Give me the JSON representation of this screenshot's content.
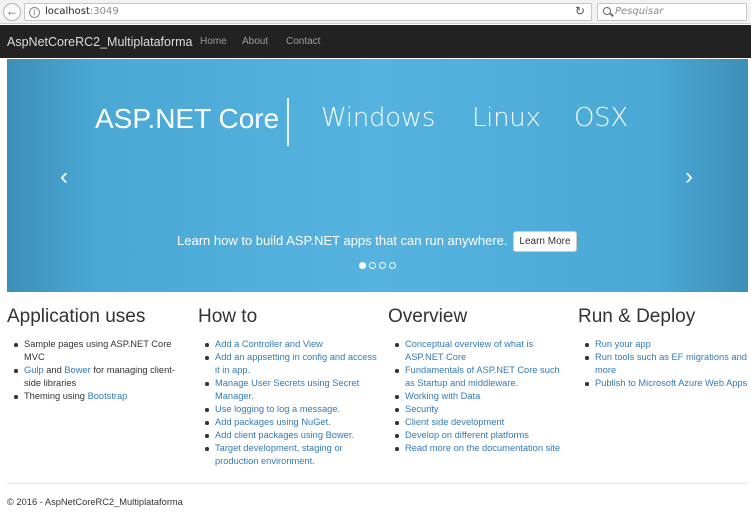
{
  "browser": {
    "url_host": "localhost",
    "url_port": ":3049",
    "search_placeholder": "Pesquisar"
  },
  "navbar": {
    "brand": "AspNetCoreRC2_Multiplataforma",
    "links": [
      "Home",
      "About",
      "Contact"
    ]
  },
  "carousel": {
    "hero": [
      "ASP.NET Core",
      "Windows",
      "Linux",
      "OSX"
    ],
    "caption": "Learn how to build ASP.NET apps that can run anywhere.",
    "button": "Learn More",
    "active_slide": 1,
    "slide_count": 4
  },
  "sections": [
    {
      "title": "Application uses",
      "items": [
        {
          "parts": [
            {
              "text": "Sample pages using ASP.NET Core MVC"
            }
          ]
        },
        {
          "parts": [
            {
              "text": "Gulp",
              "link": true
            },
            {
              "text": " and "
            },
            {
              "text": "Bower",
              "link": true
            },
            {
              "text": " for managing client-side libraries"
            }
          ]
        },
        {
          "parts": [
            {
              "text": "Theming using "
            },
            {
              "text": "Bootstrap",
              "link": true
            }
          ]
        }
      ]
    },
    {
      "title": "How to",
      "items": [
        {
          "parts": [
            {
              "text": "Add a Controller and View",
              "link": true
            }
          ]
        },
        {
          "parts": [
            {
              "text": "Add an appsetting in config and access it in app.",
              "link": true
            }
          ]
        },
        {
          "parts": [
            {
              "text": "Manage User Secrets using Secret Manager.",
              "link": true
            }
          ]
        },
        {
          "parts": [
            {
              "text": "Use logging to log a message.",
              "link": true
            }
          ]
        },
        {
          "parts": [
            {
              "text": "Add packages using NuGet.",
              "link": true
            }
          ]
        },
        {
          "parts": [
            {
              "text": "Add client packages using Bower.",
              "link": true
            }
          ]
        },
        {
          "parts": [
            {
              "text": "Target development, staging or production environment.",
              "link": true
            }
          ]
        }
      ]
    },
    {
      "title": "Overview",
      "items": [
        {
          "parts": [
            {
              "text": "Conceptual overview of what is ASP.NET Core",
              "link": true
            }
          ]
        },
        {
          "parts": [
            {
              "text": "Fundamentals of ASP.NET Core such as Startup and middleware.",
              "link": true
            }
          ]
        },
        {
          "parts": [
            {
              "text": "Working with Data",
              "link": true
            }
          ]
        },
        {
          "parts": [
            {
              "text": "Security",
              "link": true
            }
          ]
        },
        {
          "parts": [
            {
              "text": "Client side development",
              "link": true
            }
          ]
        },
        {
          "parts": [
            {
              "text": "Develop on different platforms",
              "link": true
            }
          ]
        },
        {
          "parts": [
            {
              "text": "Read more on the documentation site",
              "link": true
            }
          ]
        }
      ]
    },
    {
      "title": "Run & Deploy",
      "items": [
        {
          "parts": [
            {
              "text": "Run your app",
              "link": true
            }
          ]
        },
        {
          "parts": [
            {
              "text": "Run tools such as EF migrations and more",
              "link": true
            }
          ]
        },
        {
          "parts": [
            {
              "text": "Publish to Microsoft Azure Web Apps",
              "link": true
            }
          ]
        }
      ]
    }
  ],
  "footer": "© 2016 - AspNetCoreRC2_Multiplataforma",
  "colors": {
    "navbar_bg": "#222222",
    "link": "#337ab7",
    "carousel_blue": "#56b3df"
  }
}
